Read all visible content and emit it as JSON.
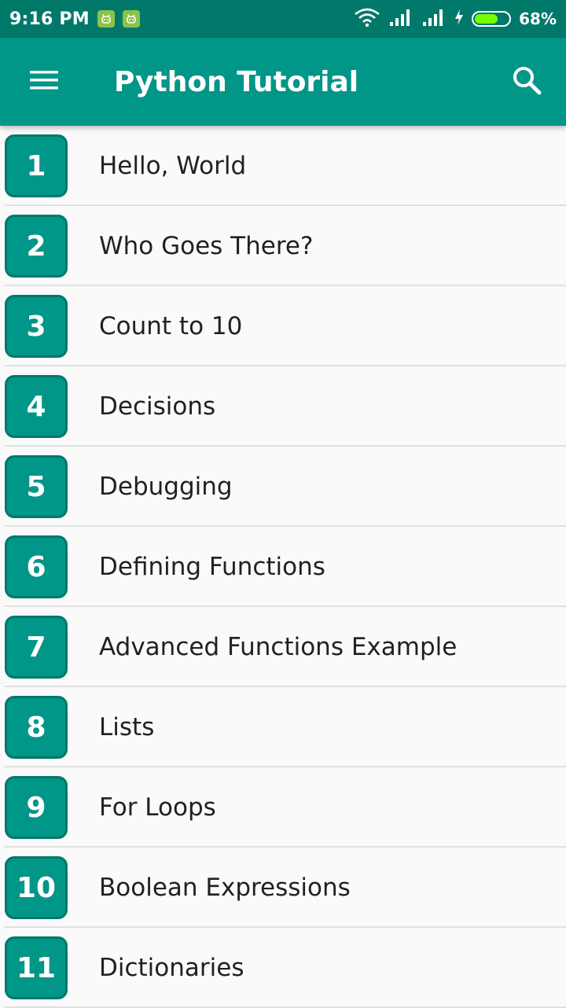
{
  "status_bar": {
    "time": "9:16 PM",
    "battery": "68%",
    "battery_level": 0.68,
    "icons": [
      "android-notification-icon",
      "android-notification-icon",
      "wifi-icon",
      "signal-icon",
      "signal-icon",
      "charging-icon",
      "battery-icon"
    ]
  },
  "app_bar": {
    "title": "Python Tutorial",
    "menu_icon": "hamburger-menu-icon",
    "search_icon": "search-icon"
  },
  "colors": {
    "primary": "#009688",
    "primary_dark": "#00796b",
    "background": "#fafafa",
    "text": "#212121",
    "divider": "#e0e0e0"
  },
  "lessons": [
    {
      "number": "1",
      "title": "Hello, World"
    },
    {
      "number": "2",
      "title": "Who Goes There?"
    },
    {
      "number": "3",
      "title": "Count to 10"
    },
    {
      "number": "4",
      "title": "Decisions"
    },
    {
      "number": "5",
      "title": "Debugging"
    },
    {
      "number": "6",
      "title": "Defining Functions"
    },
    {
      "number": "7",
      "title": "Advanced Functions Example"
    },
    {
      "number": "8",
      "title": "Lists"
    },
    {
      "number": "9",
      "title": "For Loops"
    },
    {
      "number": "10",
      "title": "Boolean Expressions"
    },
    {
      "number": "11",
      "title": "Dictionaries"
    }
  ]
}
